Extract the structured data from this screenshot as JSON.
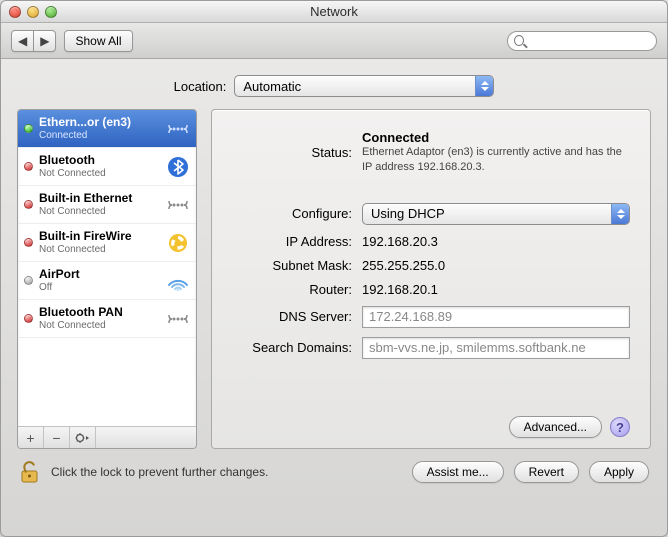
{
  "window": {
    "title": "Network"
  },
  "toolbar": {
    "show_all": "Show All",
    "search_placeholder": ""
  },
  "location": {
    "label": "Location:",
    "value": "Automatic"
  },
  "sidebar": {
    "items": [
      {
        "name": "Ethern...or (en3)",
        "status": "Connected",
        "led": "green",
        "icon": "ethernet",
        "selected": true
      },
      {
        "name": "Bluetooth",
        "status": "Not Connected",
        "led": "red",
        "icon": "bluetooth",
        "selected": false
      },
      {
        "name": "Built-in Ethernet",
        "status": "Not Connected",
        "led": "red",
        "icon": "ethernet",
        "selected": false
      },
      {
        "name": "Built-in FireWire",
        "status": "Not Connected",
        "led": "red",
        "icon": "firewire",
        "selected": false
      },
      {
        "name": "AirPort",
        "status": "Off",
        "led": "gray",
        "icon": "airport",
        "selected": false
      },
      {
        "name": "Bluetooth PAN",
        "status": "Not Connected",
        "led": "red",
        "icon": "ethernet",
        "selected": false
      }
    ]
  },
  "details": {
    "status_label": "Status:",
    "status_value": "Connected",
    "status_desc": "Ethernet Adaptor (en3) is currently active and has the IP address 192.168.20.3.",
    "configure_label": "Configure:",
    "configure_value": "Using DHCP",
    "ip_label": "IP Address:",
    "ip_value": "192.168.20.3",
    "mask_label": "Subnet Mask:",
    "mask_value": "255.255.255.0",
    "router_label": "Router:",
    "router_value": "192.168.20.1",
    "dns_label": "DNS Server:",
    "dns_value": "172.24.168.89",
    "search_label": "Search Domains:",
    "search_value": "sbm-vvs.ne.jp, smilemms.softbank.ne",
    "advanced": "Advanced..."
  },
  "footer": {
    "lock_msg": "Click the lock to prevent further changes.",
    "assist": "Assist me...",
    "revert": "Revert",
    "apply": "Apply"
  }
}
